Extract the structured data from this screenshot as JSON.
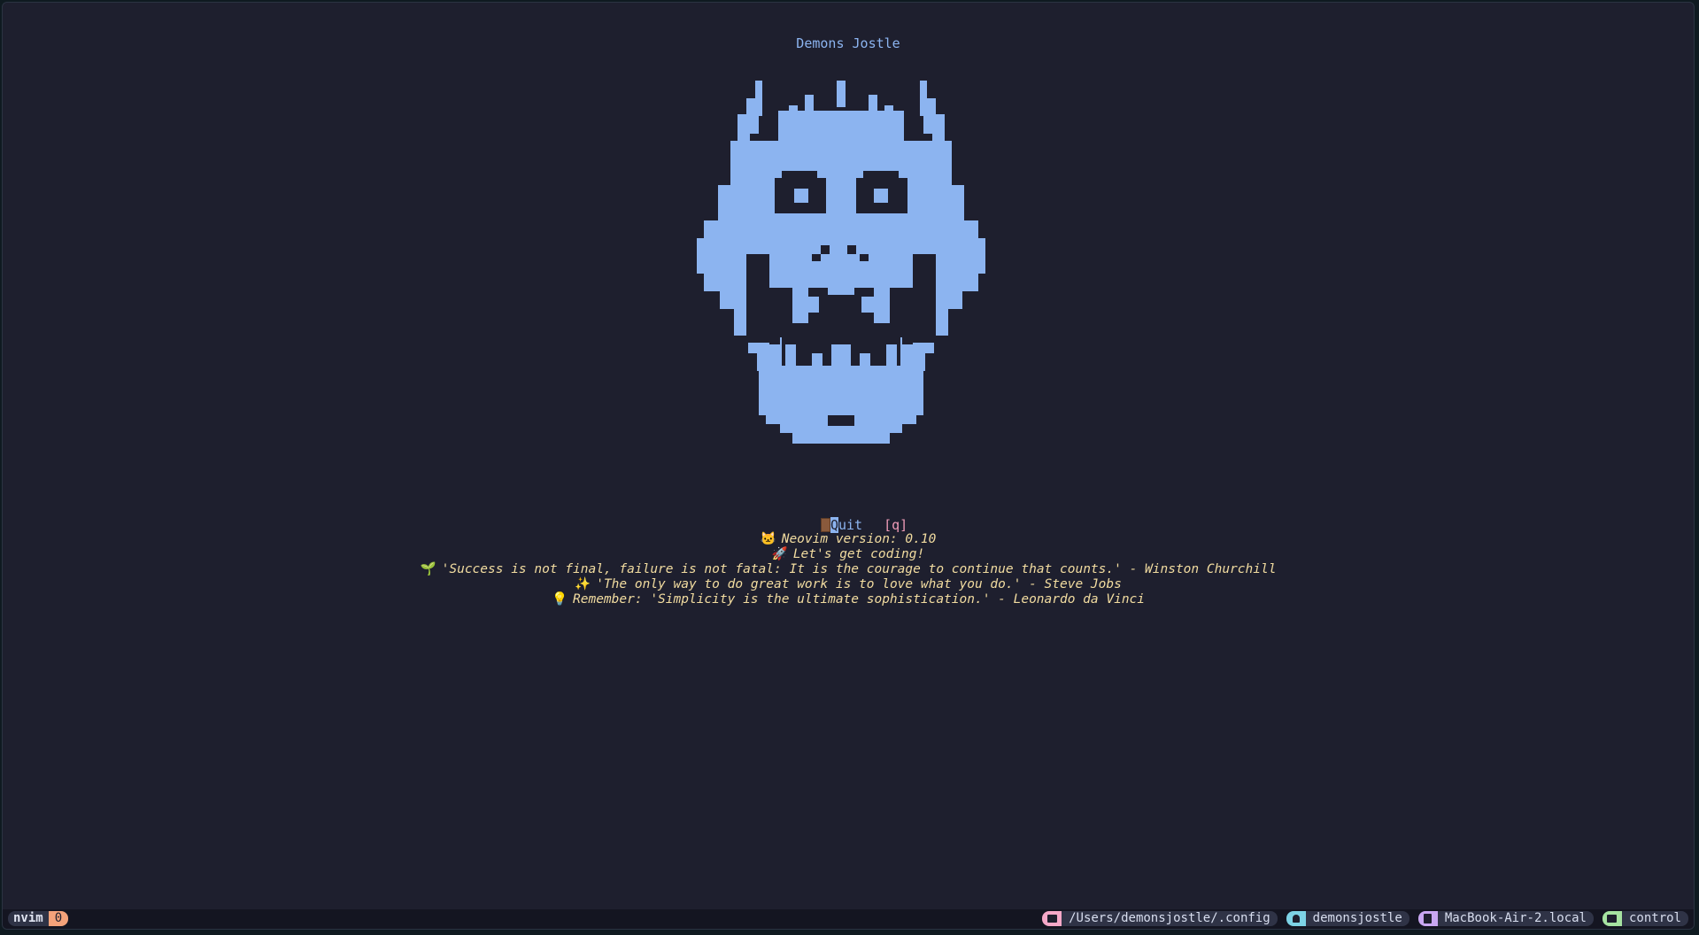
{
  "header": {
    "title": "Demons Jostle"
  },
  "logo": {
    "icon": "bowser-skull-ascii-art",
    "color": "#8cb4f0"
  },
  "menu": {
    "quit": {
      "icon": "door-icon",
      "cursor_char": "Q",
      "label_rest": "uit",
      "key": "[q]"
    }
  },
  "footer": {
    "lines": [
      {
        "emoji": "🐱",
        "text": "Neovim version: 0.10"
      },
      {
        "emoji": "🚀",
        "text": "Let's get coding!"
      },
      {
        "emoji": "🌱",
        "text": "'Success is not final, failure is not fatal: It is the courage to continue that counts.' - Winston Churchill"
      },
      {
        "emoji": "✨",
        "text": "'The only way to do great work is to love what you do.' - Steve Jobs"
      },
      {
        "emoji": "💡",
        "text": "Remember: 'Simplicity is the ultimate sophistication.' - Leonardo da Vinci"
      }
    ]
  },
  "statusbar": {
    "session_name": "nvim",
    "window_index": "0",
    "segments": [
      {
        "icon": "folder-icon",
        "color": "#f5a8c8",
        "text": "/Users/demonsjostle/.config"
      },
      {
        "icon": "user-icon",
        "color": "#7dd3e6",
        "text": "demonsjostle"
      },
      {
        "icon": "server-icon",
        "color": "#c9a7f2",
        "text": "MacBook-Air-2.local"
      },
      {
        "icon": "terminal-icon",
        "color": "#a6e3a1",
        "text": "control"
      }
    ]
  },
  "colors": {
    "background": "#1e1f2e",
    "accent": "#8cb4f0",
    "footer_text": "#f2dca0",
    "key_hint": "#f09cb8"
  }
}
